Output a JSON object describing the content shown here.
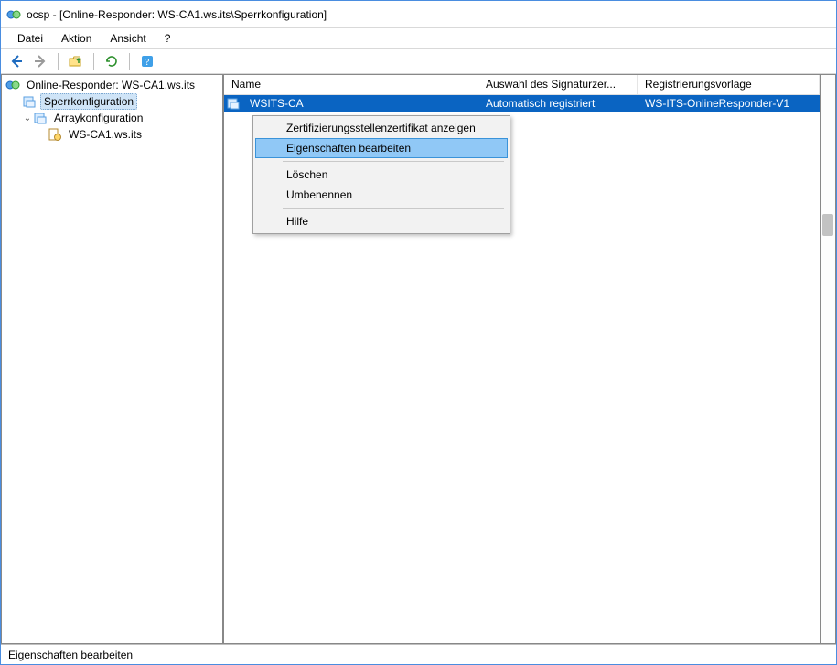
{
  "window": {
    "title": "ocsp - [Online-Responder: WS-CA1.ws.its\\Sperrkonfiguration]"
  },
  "menu": {
    "items": [
      "Datei",
      "Aktion",
      "Ansicht",
      "?"
    ]
  },
  "toolbar": {
    "back_icon": "back-arrow-icon",
    "forward_icon": "forward-arrow-icon",
    "up_icon": "folder-up-icon",
    "refresh_icon": "refresh-icon",
    "help_icon": "help-icon"
  },
  "tree": {
    "root": {
      "label": "Online-Responder: WS-CA1.ws.its",
      "children": [
        {
          "label": "Sperrkonfiguration",
          "selected": true
        },
        {
          "label": "Arraykonfiguration",
          "expanded": true,
          "children": [
            {
              "label": "WS-CA1.ws.its"
            }
          ]
        }
      ]
    }
  },
  "list": {
    "columns": {
      "name": "Name",
      "signer": "Auswahl des Signaturzer...",
      "enrollment": "Registrierungsvorlage"
    },
    "rows": [
      {
        "name": "WSITS-CA",
        "signer": "Automatisch registriert",
        "enrollment": "WS-ITS-OnlineResponder-V1",
        "selected": true
      }
    ]
  },
  "context_menu": {
    "items": [
      {
        "label": "Zertifizierungsstellenzertifikat anzeigen"
      },
      {
        "label": "Eigenschaften bearbeiten",
        "hover": true
      },
      {
        "sep": true
      },
      {
        "label": "Löschen"
      },
      {
        "label": "Umbenennen"
      },
      {
        "sep": true
      },
      {
        "label": "Hilfe"
      }
    ]
  },
  "statusbar": {
    "text": "Eigenschaften bearbeiten"
  }
}
